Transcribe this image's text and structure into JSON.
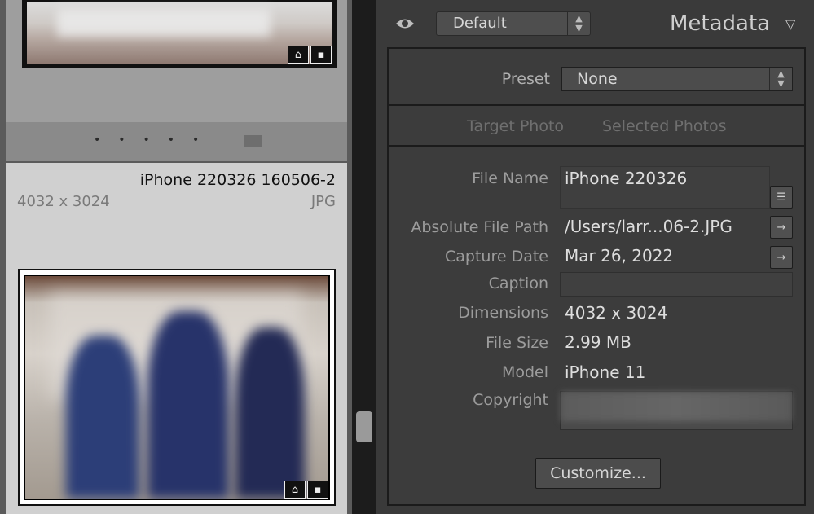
{
  "grid": {
    "thumbnail": {
      "name": "iPhone 220326 160506-2",
      "dimensions": "4032 x 3024",
      "type": "JPG"
    },
    "badges": [
      "tag-icon",
      "comment-icon"
    ]
  },
  "panel": {
    "visibility_icon": "eye-icon",
    "metadata_set": "Default",
    "title": "Metadata",
    "preset": {
      "label": "Preset",
      "value": "None"
    },
    "target_tabs": [
      "Target Photo",
      "Selected Photos"
    ],
    "fields": {
      "file_name": {
        "label": "File Name",
        "value": "iPhone 220326"
      },
      "absolute_file_path": {
        "label": "Absolute File Path",
        "value": "/Users/larr...06-2.JPG"
      },
      "capture_date": {
        "label": "Capture Date",
        "value": "Mar 26, 2022"
      },
      "caption": {
        "label": "Caption",
        "value": ""
      },
      "dimensions": {
        "label": "Dimensions",
        "value": "4032 x 3024"
      },
      "file_size": {
        "label": "File Size",
        "value": "2.99 MB"
      },
      "model": {
        "label": "Model",
        "value": "iPhone 11"
      },
      "copyright": {
        "label": "Copyright",
        "value": ""
      }
    },
    "customize_label": "Customize..."
  },
  "colors": {
    "panel_bg": "#3a3a3a",
    "grid_bg": "#5b5b5b",
    "selected_cell": "#d0d0d0",
    "text_light": "#dedede"
  }
}
